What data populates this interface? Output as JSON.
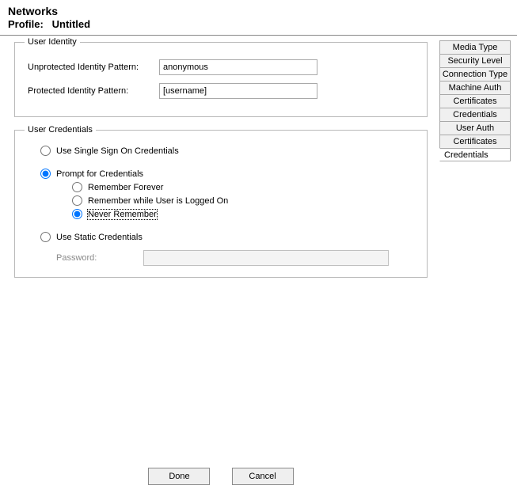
{
  "header": {
    "title": "Networks",
    "profile_label": "Profile:",
    "profile_name": "Untitled"
  },
  "tabs": [
    {
      "label": "Media Type",
      "selected": false
    },
    {
      "label": "Security Level",
      "selected": false
    },
    {
      "label": "Connection Type",
      "selected": false
    },
    {
      "label": "Machine Auth",
      "selected": false
    },
    {
      "label": "Certificates",
      "selected": false
    },
    {
      "label": "Credentials",
      "selected": false
    },
    {
      "label": "User Auth",
      "selected": false
    },
    {
      "label": "Certificates",
      "selected": false
    },
    {
      "label": "Credentials",
      "selected": true
    }
  ],
  "identity_group": {
    "legend": "User Identity",
    "unprotected_label": "Unprotected Identity Pattern:",
    "unprotected_value": "anonymous",
    "protected_label": "Protected Identity Pattern:",
    "protected_value": "[username]"
  },
  "credentials_group": {
    "legend": "User Credentials",
    "options": {
      "use_sso": "Use Single Sign On Credentials",
      "prompt": "Prompt for Credentials",
      "remember_forever": "Remember Forever",
      "remember_logged_on": "Remember while User is Logged On",
      "never_remember": "Never Remember",
      "use_static": "Use Static Credentials"
    },
    "selected_top": "prompt",
    "selected_sub": "never_remember",
    "password_label": "Password:",
    "password_value": ""
  },
  "buttons": {
    "done": "Done",
    "cancel": "Cancel"
  }
}
